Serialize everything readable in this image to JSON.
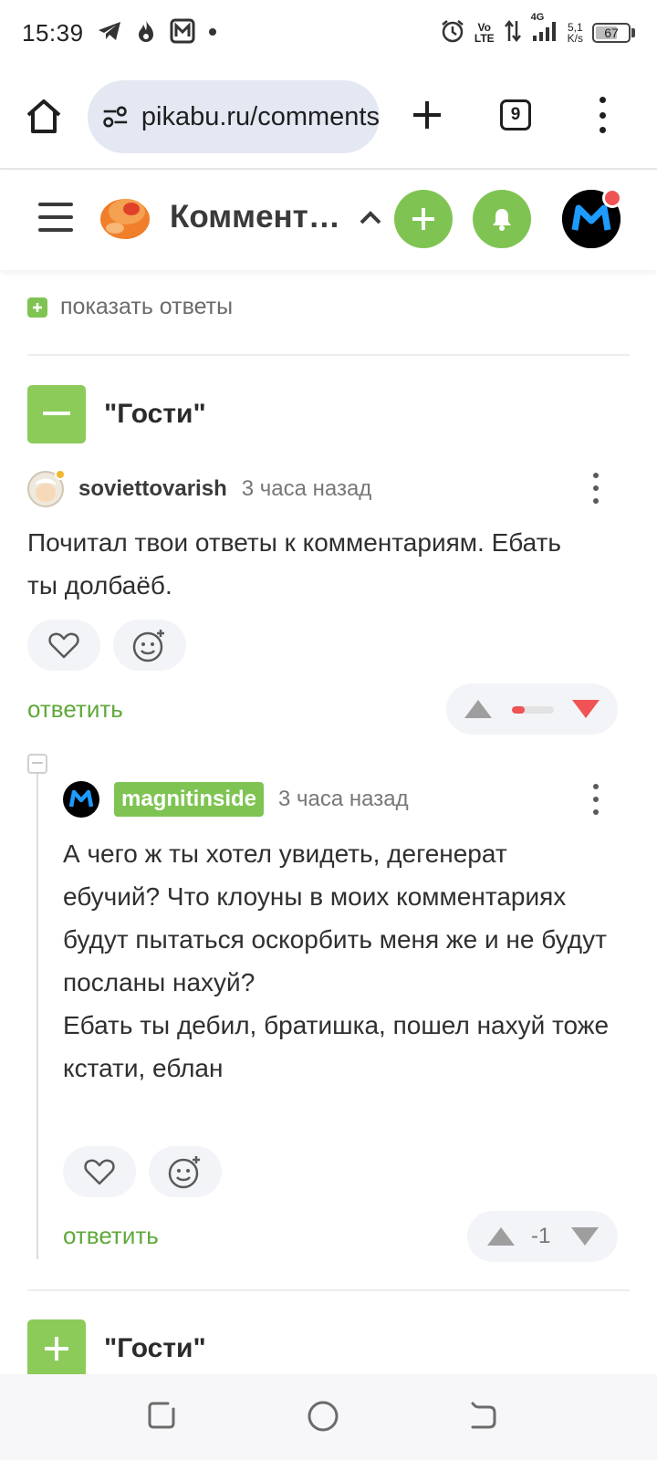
{
  "status_bar": {
    "time": "15:39",
    "volte_top": "Vo",
    "volte_bottom": "LTE",
    "network": "4G",
    "speed_top": "5,1",
    "speed_bottom": "K/s",
    "battery": "67",
    "battery_level": 0.67
  },
  "browser": {
    "url": "pikabu.ru/comments",
    "tab_count": "9"
  },
  "site_header": {
    "title": "Комментарии"
  },
  "top": {
    "show_replies": "показать ответы"
  },
  "group1": {
    "title": "\"Гости\""
  },
  "comment1": {
    "author": "soviettovarish",
    "time": "3 часа назад",
    "text": "Почитал твои ответы к комментариям. Ебать ты долбаёб.",
    "reply_label": "ответить",
    "rating_negative_share": 0.3
  },
  "comment2": {
    "author": "magnitinside",
    "time": "3 часа назад",
    "text": "А чего ж ты хотел увидеть, дегенерат ебучий? Что клоуны в моих комментариях будут пытаться оскорбить меня же и не будут посланы нахуй?\nЕбать ты дебил, братишка, пошел нахуй тоже кстати, еблан",
    "reply_label": "ответить",
    "score": "-1"
  },
  "group2": {
    "title": "\"Гости\""
  },
  "colors": {
    "accent_green": "#7fc452",
    "link_green": "#5fa83a",
    "vote_red": "#ef5353",
    "vote_gray": "#9e9e9e"
  }
}
